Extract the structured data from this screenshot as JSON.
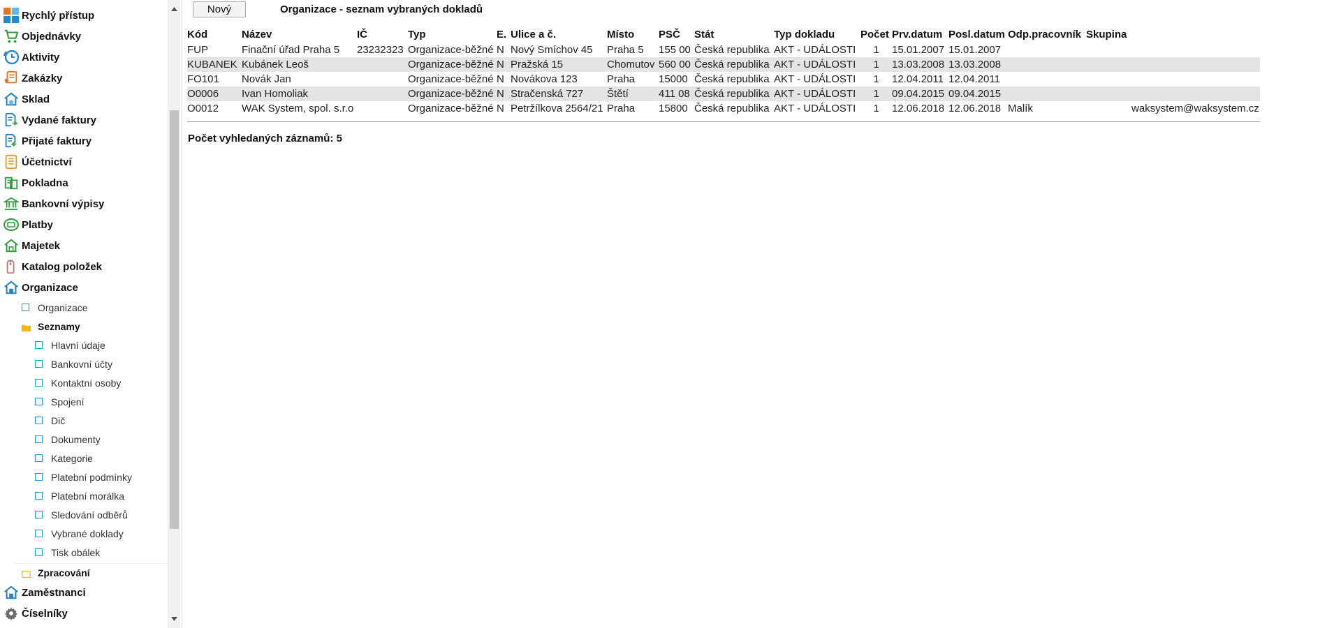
{
  "sidebar": {
    "items": [
      {
        "label": "Rychlý přístup",
        "icon": "quick-access-icon"
      },
      {
        "label": "Objednávky",
        "icon": "cart-icon"
      },
      {
        "label": "Aktivity",
        "icon": "clock-icon"
      },
      {
        "label": "Zakázky",
        "icon": "orders-document-icon"
      },
      {
        "label": "Sklad",
        "icon": "warehouse-house-icon"
      },
      {
        "label": "Vydané faktury",
        "icon": "issued-invoice-icon"
      },
      {
        "label": "Přijaté faktury",
        "icon": "received-invoice-icon"
      },
      {
        "label": "Účetnictví",
        "icon": "ledger-icon"
      },
      {
        "label": "Pokladna",
        "icon": "cash-register-icon"
      },
      {
        "label": "Bankovní výpisy",
        "icon": "bank-icon"
      },
      {
        "label": "Platby",
        "icon": "payment-coin-icon"
      },
      {
        "label": "Majetek",
        "icon": "property-house-icon"
      },
      {
        "label": "Katalog položek",
        "icon": "price-tag-icon"
      },
      {
        "label": "Organizace",
        "icon": "organization-house-icon"
      }
    ],
    "organizace_children": {
      "organizace": "Organizace",
      "seznamy": "Seznamy",
      "seznamy_items": [
        "Hlavní údaje",
        "Bankovní účty",
        "Kontaktní osoby",
        "Spojení",
        "Dič",
        "Dokumenty",
        "Kategorie",
        "Platební podmínky",
        "Platební morálka",
        "Sledování odběrů",
        "Vybrané doklady",
        "Tisk obálek"
      ],
      "zpracovani": "Zpracování"
    },
    "bottom_items": [
      {
        "label": "Zaměstnanci",
        "icon": "employees-house-icon"
      },
      {
        "label": "Číselníky",
        "icon": "gear-icon"
      }
    ]
  },
  "main": {
    "new_button_label": "Nový",
    "title": "Organizace - seznam vybraných dokladů",
    "table": {
      "columns": [
        "Kód",
        "Název",
        "IČ",
        "Typ",
        "E.",
        "Ulice a č.",
        "Místo",
        "PSČ",
        "Stát",
        "Typ dokladu",
        "Počet",
        "Prv.datum",
        "Posl.datum",
        "Odp.pracovník",
        "Skupina",
        ""
      ],
      "rows": [
        [
          "FUP",
          "Finační úřad Praha 5",
          "23232323",
          "Organizace-běžné",
          "N",
          "Nový Smíchov 45",
          "Praha 5",
          "155 00",
          "Česká republika",
          "AKT - UDÁLOSTI",
          "1",
          "15.01.2007",
          "15.01.2007",
          "",
          "",
          ""
        ],
        [
          "KUBANEK",
          "Kubánek Leoš",
          "",
          "Organizace-běžné",
          "N",
          "Pražská 15",
          "Chomutov",
          "560 00",
          "Česká republika",
          "AKT - UDÁLOSTI",
          "1",
          "13.03.2008",
          "13.03.2008",
          "",
          "",
          ""
        ],
        [
          "FO101",
          "Novák Jan",
          "",
          "Organizace-běžné",
          "N",
          "Novákova 123",
          "Praha",
          "15000",
          "Česká republika",
          "AKT - UDÁLOSTI",
          "1",
          "12.04.2011",
          "12.04.2011",
          "",
          "",
          ""
        ],
        [
          "O0006",
          "Ivan Homoliak",
          "",
          "Organizace-běžné",
          "N",
          "Stračenská 727",
          "Štětí",
          "411 08",
          "Česká republika",
          "AKT - UDÁLOSTI",
          "1",
          "09.04.2015",
          "09.04.2015",
          "",
          "",
          ""
        ],
        [
          "O0012",
          "WAK System, spol. s.r.o",
          "",
          "Organizace-běžné",
          "N",
          "Petržílkova 2564/21",
          "Praha",
          "15800",
          "Česká republika",
          "AKT - UDÁLOSTI",
          "1",
          "12.06.2018",
          "12.06.2018",
          "Malík",
          "",
          "waksystem@waksystem.cz"
        ]
      ]
    },
    "record_count": "Počet vyhledaných záznamů: 5"
  },
  "colors": {
    "accent_blue": "#1e9be0",
    "folder_yellow": "#f5b800",
    "alt_row": "#e4e4e4",
    "green_icon": "#2e9d3a"
  }
}
